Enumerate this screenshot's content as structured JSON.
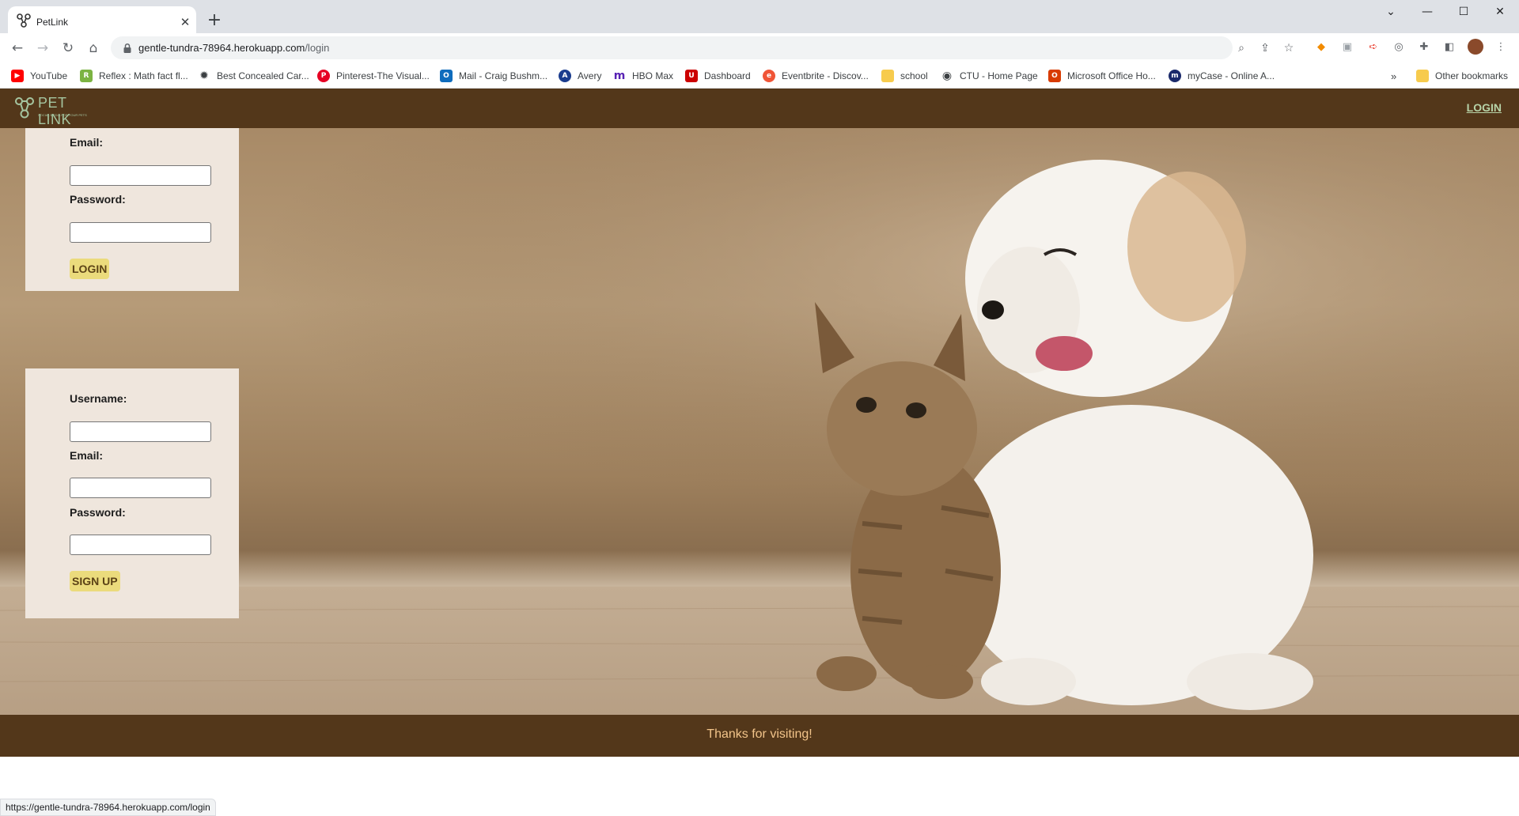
{
  "browser": {
    "tab": {
      "title": "PetLink"
    },
    "address": {
      "host": "gentle-tundra-78964.herokuapp.com",
      "path": "/login"
    },
    "bookmarks": [
      {
        "label": "YouTube",
        "icon": "youtube-icon",
        "color": "#ff0000"
      },
      {
        "label": "Reflex : Math fact fl...",
        "icon": "reflex-icon",
        "color": "#7cb342"
      },
      {
        "label": "Best Concealed Car...",
        "icon": "gear-icon",
        "color": "#3c4043"
      },
      {
        "label": "Pinterest-The Visual...",
        "icon": "pinterest-icon",
        "color": "#e60023"
      },
      {
        "label": "Mail - Craig Bushm...",
        "icon": "outlook-icon",
        "color": "#0f6cbd"
      },
      {
        "label": "Avery",
        "icon": "avery-icon",
        "color": "#1a3c8e"
      },
      {
        "label": "HBO Max",
        "icon": "hbomax-icon",
        "color": "#5822b4"
      },
      {
        "label": "Dashboard",
        "icon": "dashboard-icon",
        "color": "#cc0000"
      },
      {
        "label": "Eventbrite - Discov...",
        "icon": "eventbrite-icon",
        "color": "#f05537"
      },
      {
        "label": "school",
        "icon": "folder-icon",
        "color": "#f7cb4d"
      },
      {
        "label": "CTU - Home Page",
        "icon": "globe-icon",
        "color": "#3c4043"
      },
      {
        "label": "Microsoft Office Ho...",
        "icon": "office-icon",
        "color": "#d83b01"
      },
      {
        "label": "myCase - Online A...",
        "icon": "mycase-icon",
        "color": "#1b2a6b"
      }
    ],
    "other_bookmarks": "Other bookmarks",
    "status_url": "https://gentle-tundra-78964.herokuapp.com/login"
  },
  "site": {
    "logo_text": "PET LINK",
    "logo_tagline": "SOCIAL MEDIA FOR YOUR PETS",
    "nav_login": "LOGIN",
    "login_form": {
      "email_label": "Email:",
      "password_label": "Password:",
      "submit": "LOGIN"
    },
    "signup_form": {
      "username_label": "Username:",
      "email_label": "Email:",
      "password_label": "Password:",
      "submit": "SIGN UP"
    },
    "footer_text": "Thanks for visiting!"
  },
  "colors": {
    "header_bg": "#53371a",
    "panel_bg": "#efe6dd",
    "button_bg": "#ebdb7c",
    "footer_text": "#f2c48a",
    "nav_link": "#b7d3a8"
  }
}
